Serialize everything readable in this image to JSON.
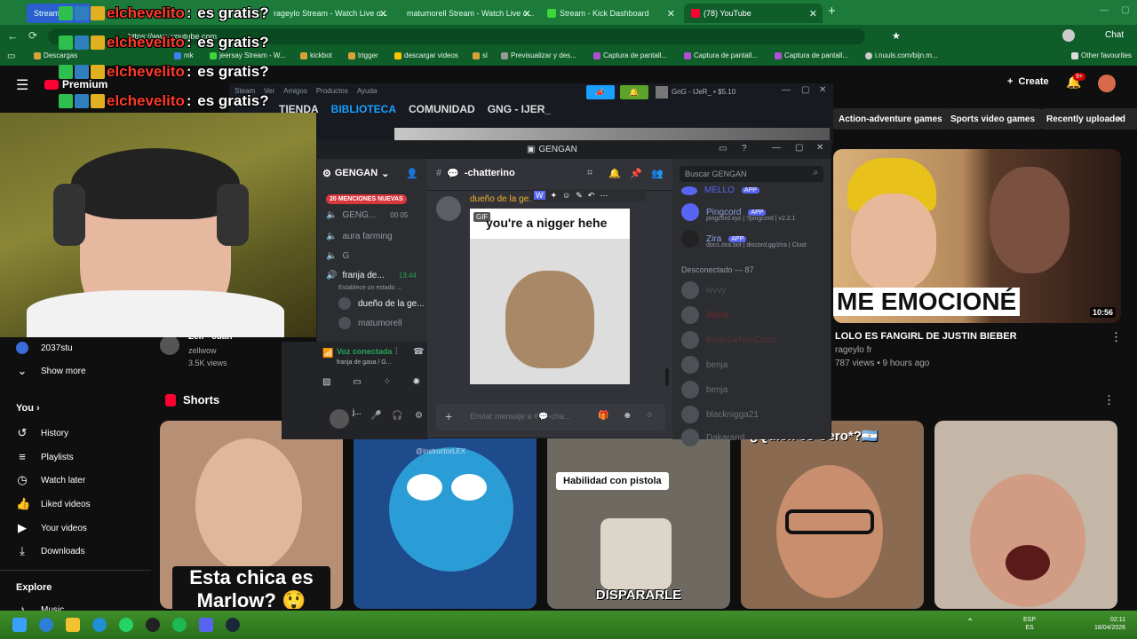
{
  "browser": {
    "tabs": [
      {
        "label": "Stream V..."
      },
      {
        "label": "rageylo Stream - Watch Live o..."
      },
      {
        "label": "matumorell Stream - Watch Live o..."
      },
      {
        "label": "Stream - Kick Dashboard"
      },
      {
        "label": "(78) YouTube"
      }
    ],
    "url": "https://www.youtube.com",
    "bookmarks": [
      "Descargas",
      "mk",
      "jeersay Stream - W...",
      "kickbot",
      "trigger",
      "descargar videos",
      "sl",
      "Previsualizar y des...",
      "Captura de pantall...",
      "Captura de pantall...",
      "Captura de pantall...",
      "i.nuuls.com/bijn.m..."
    ],
    "other_favourites": "Other favourites",
    "profile_label": "Chat"
  },
  "overlay_chat": {
    "username": "elchevelito",
    "message": "es gratis?",
    "premium": "Premium"
  },
  "youtube": {
    "create_label": "Create",
    "notif_count": "9+",
    "chips": [
      "Action-adventure games",
      "Sports video games",
      "Recently uploaded"
    ],
    "video": {
      "title": "LOLO ES FANGIRL DE JUSTIN BIEBER",
      "channel": "rageylo fr",
      "meta": "787 views • 9 hours ago",
      "duration": "10:56",
      "overlay_text": "ME EMOCIONÉ"
    },
    "left_video": {
      "channel": "zellwow",
      "views": "3.5K views",
      "title_partial": "Zell - cuan"
    },
    "side_channel": "2037stu",
    "show_more": "Show more",
    "you_label": "You",
    "sidebar": [
      {
        "label": "History",
        "icon": "history-icon"
      },
      {
        "label": "Playlists",
        "icon": "playlists-icon"
      },
      {
        "label": "Watch later",
        "icon": "watch-later-icon"
      },
      {
        "label": "Liked videos",
        "icon": "liked-icon"
      },
      {
        "label": "Your videos",
        "icon": "your-videos-icon"
      },
      {
        "label": "Downloads",
        "icon": "downloads-icon"
      }
    ],
    "explore_label": "Explore",
    "music_label": "Music",
    "shorts_label": "Shorts",
    "shorts": [
      {
        "caption": "Esta chica es Marlow? 😲",
        "bg": "#b78f74"
      },
      {
        "caption": "@instructorLEX",
        "bg": "#1e4b8c"
      },
      {
        "caption": "DISPARARLE",
        "top_caption": "Habilidad con pistola",
        "bg": "#6e6a62"
      },
      {
        "caption": "¿Quién es Cero*?🇦🇷",
        "bg": "#8a6a50"
      },
      {
        "caption": "",
        "bg": "#c4b7a8"
      }
    ]
  },
  "steam": {
    "menu": [
      "Steam",
      "Ver",
      "Amigos",
      "Productos",
      "Ayuda"
    ],
    "nav": [
      "TIENDA",
      "BIBLIOTECA",
      "COMUNIDAD",
      "GNG - IJER_"
    ],
    "user": "GnG - IJeR_",
    "balance": "$5.10"
  },
  "discord": {
    "window_title": "GENGAN",
    "server_name": "GENGAN",
    "channel_name": "-chatterino",
    "search_placeholder": "Buscar GENGAN",
    "mentions_badge": "20 MENCIONES NUEVAS",
    "channels": [
      {
        "label": "GENG...",
        "extra": "00  05"
      },
      {
        "label": "aura farming",
        "extra": ""
      },
      {
        "label": "G",
        "extra": ""
      },
      {
        "label": "franja de...",
        "extra": "13:44"
      }
    ],
    "status_line": "Establece un estado ...",
    "voice_users": [
      "dueño de la ge...",
      "matumorell"
    ],
    "voice_connected": "Voz conectada",
    "voice_channel": "franja de gasa / G...",
    "message_author": "dueño de la ge...",
    "gif_label": "GIF",
    "gif_caption": "you're a nigger hehe",
    "input_placeholder": "Enviar mensaje a #💬-cha...",
    "members_apps": [
      {
        "name": "MELLO",
        "tag": "APP",
        "sub": ""
      },
      {
        "name": "Pingcord",
        "tag": "APP",
        "sub": "pingcord.xyz | ?pingcord | v2.2.1"
      },
      {
        "name": "Zira",
        "tag": "APP",
        "sub": "docs.zira.bot | discord.gg/zira | Clust"
      }
    ],
    "offline_header": "Desconectado — 87",
    "offline_members": [
      "ivvvy",
      "illiana",
      "BerteDeNenDazo",
      "benja",
      "benja",
      "blacknigga21",
      "Dakarand"
    ]
  },
  "taskbar": {
    "lang": "ESP",
    "region": "ES",
    "time": "02:11",
    "date": "18/04/2026"
  },
  "colors": {
    "chrome_green": "#1c7a3a",
    "yt_bg": "#0f0f0f",
    "discord_bg": "#313338",
    "mention_red": "#da373c",
    "blurple": "#5865f2",
    "steam_blue": "#1a9fff"
  }
}
